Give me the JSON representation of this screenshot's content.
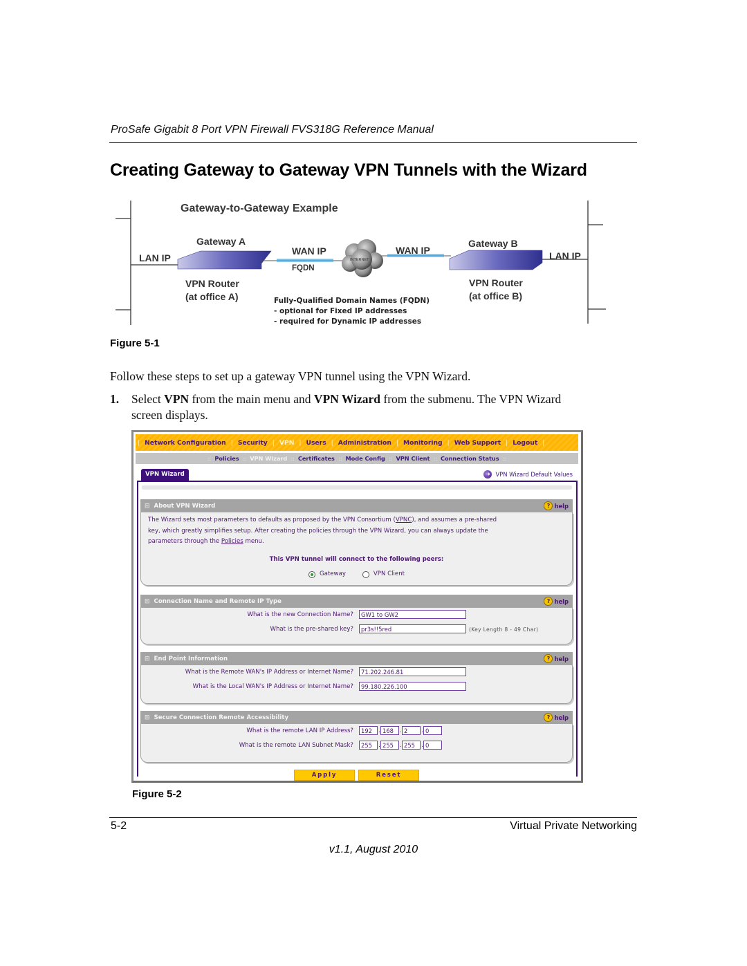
{
  "document": {
    "running_head": "ProSafe Gigabit 8 Port VPN Firewall FVS318G Reference Manual",
    "section_title": "Creating Gateway to Gateway VPN Tunnels with the Wizard",
    "figure1_caption": "Figure 5-1",
    "intro": "Follow these steps to set up a gateway VPN tunnel using the VPN Wizard.",
    "step1": {
      "number": "1.",
      "pre": "Select ",
      "b1": "VPN",
      "mid": " from the main menu and ",
      "b2": "VPN Wizard",
      "post": " from the submenu. The VPN Wizard",
      "line2": "screen displays."
    },
    "figure2_caption": "Figure 5-2",
    "footer_left": "5-2",
    "footer_right": "Virtual Private Networking",
    "version": "v1.1, August 2010"
  },
  "diagram": {
    "title": "Gateway-to-Gateway Example",
    "gateway_a": "Gateway A",
    "gateway_b": "Gateway B",
    "lan_ip_a": "LAN IP",
    "lan_ip_b": "LAN IP",
    "wan_ip_a": "WAN IP",
    "wan_ip_b": "WAN IP",
    "fqdn": "FQDN",
    "internet": "INTERNET",
    "router_a_line1": "VPN Router",
    "router_a_line2": "(at office A)",
    "router_b_line1": "VPN Router",
    "router_b_line2": "(at office B)",
    "note_title": "Fully-Qualified Domain Names (FQDN)",
    "note_line1": "- optional for Fixed IP addresses",
    "note_line2": "- required for Dynamic IP addresses"
  },
  "ui": {
    "main_menu": [
      "Network Configuration",
      "Security",
      "VPN",
      "Users",
      "Administration",
      "Monitoring",
      "Web Support",
      "Logout"
    ],
    "main_menu_active": "VPN",
    "sub_menu": [
      "Policies",
      "VPN Wizard",
      "Certificates",
      "Mode Config",
      "VPN Client",
      "Connection Status"
    ],
    "sub_menu_active": "VPN Wizard",
    "tab": "VPN Wizard",
    "defaults_link": "VPN Wizard Default Values",
    "help_label": "help",
    "about": {
      "title": "About VPN Wizard",
      "text_line1_a": "The Wizard sets most parameters to defaults as proposed by the VPN Consortium (",
      "text_line1_link": "VPNC",
      "text_line1_b": "), and assumes a pre-shared",
      "text_line2": "key, which greatly simplifies setup. After creating the policies through the VPN Wizard, you can always update the",
      "text_line3_a": "parameters through the ",
      "text_line3_link": "Policies",
      "text_line3_b": " menu.",
      "peers_title": "This VPN tunnel will connect to the following peers:",
      "peer_options": [
        "Gateway",
        "VPN Client"
      ],
      "peer_selected": "Gateway"
    },
    "connection": {
      "title": "Connection Name and Remote IP Type",
      "name_q": "What is the new Connection Name?",
      "name_value": "GW1 to GW2",
      "key_q": "What is the pre-shared key?",
      "key_value": "pr3s!!5red",
      "key_hint": "(Key Length 8 - 49 Char)"
    },
    "endpoint": {
      "title": "End Point Information",
      "remote_q": "What is the Remote WAN's IP Address or Internet Name?",
      "remote_value": "71.202.246.81",
      "local_q": "What is the Local WAN's IP Address or Internet Name?",
      "local_value": "99.180.226.100"
    },
    "secure": {
      "title": "Secure Connection Remote Accessibility",
      "lan_ip_q": "What is the remote LAN IP Address?",
      "lan_ip": [
        "192",
        "168",
        "2",
        "0"
      ],
      "mask_q": "What is the remote LAN Subnet Mask?",
      "mask": [
        "255",
        "255",
        "255",
        "0"
      ]
    },
    "apply_label": "Apply",
    "reset_label": "Reset"
  }
}
